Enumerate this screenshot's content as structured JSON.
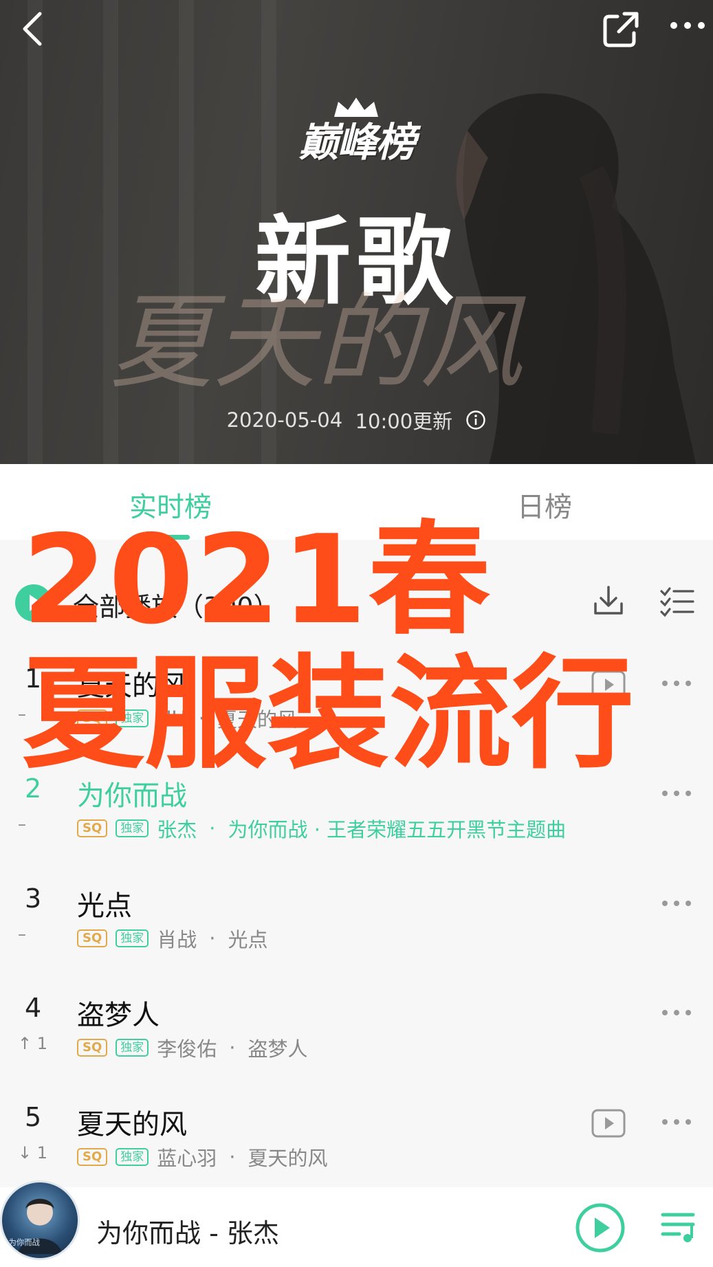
{
  "header": {
    "brand": "巅峰榜",
    "chart_name": "新歌",
    "update_date": "2020-05-04",
    "update_time": "10:00更新",
    "background_art_text": "夏天的风"
  },
  "tabs": [
    {
      "label": "实时榜",
      "active": true
    },
    {
      "label": "日榜",
      "active": false
    }
  ],
  "play_all": {
    "label": "全部播放（300）"
  },
  "songs": [
    {
      "rank": "1",
      "title": "夏天的风",
      "trend": "–",
      "artist": "UU",
      "album": "夏天的风",
      "active": false,
      "has_mv": true
    },
    {
      "rank": "2",
      "title": "为你而战",
      "trend": "–",
      "artist": "张杰",
      "album": "为你而战 · 王者荣耀五五开黑节主题曲",
      "active": true,
      "has_mv": false
    },
    {
      "rank": "3",
      "title": "光点",
      "trend": "–",
      "artist": "肖战",
      "album": "光点",
      "active": false,
      "has_mv": false
    },
    {
      "rank": "4",
      "title": "盗梦人",
      "trend": "↑ 1",
      "artist": "李俊佑",
      "album": "盗梦人",
      "active": false,
      "has_mv": false
    },
    {
      "rank": "5",
      "title": "夏天的风",
      "trend": "↓ 1",
      "artist": "蓝心羽",
      "album": "夏天的风",
      "active": false,
      "has_mv": true
    }
  ],
  "badges": {
    "quality": "SQ",
    "exclusive": "独家"
  },
  "overlay": {
    "line1": "2021春",
    "line2": "夏服装流行"
  },
  "player": {
    "now_playing": "为你而战 - 张杰",
    "cover_text": "为你而战"
  },
  "colors": {
    "accent": "#3fcf9f",
    "overlay": "#ff4d1a",
    "sq": "#e2a94a"
  },
  "icons": [
    "back-icon",
    "share-icon",
    "more-icon",
    "info-icon",
    "play-icon",
    "download-icon",
    "multi-select-icon",
    "mv-icon",
    "more-dots-icon",
    "playlist-icon"
  ]
}
